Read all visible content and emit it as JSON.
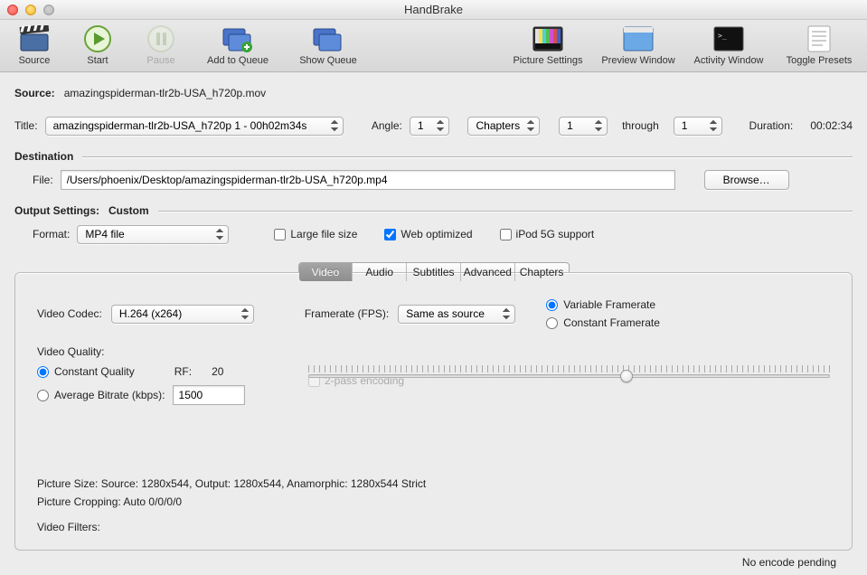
{
  "window": {
    "title": "HandBrake"
  },
  "toolbar_left": [
    {
      "label": "Source",
      "name": "source-button",
      "icon": "clapper"
    },
    {
      "label": "Start",
      "name": "start-button",
      "icon": "play"
    },
    {
      "label": "Pause",
      "name": "pause-button",
      "icon": "pause",
      "disabled": true
    },
    {
      "label": "Add to Queue",
      "name": "add-to-queue-button",
      "icon": "queue-add",
      "wide": true
    },
    {
      "label": "Show Queue",
      "name": "show-queue-button",
      "icon": "queue-show",
      "wide": true
    }
  ],
  "toolbar_right": [
    {
      "label": "Picture Settings",
      "name": "picture-settings-button",
      "icon": "test-pattern",
      "wide": true
    },
    {
      "label": "Preview Window",
      "name": "preview-window-button",
      "icon": "preview",
      "wide": true
    },
    {
      "label": "Activity Window",
      "name": "activity-window-button",
      "icon": "terminal",
      "wide": true
    },
    {
      "label": "Toggle Presets",
      "name": "toggle-presets-button",
      "icon": "presets",
      "wide": true
    }
  ],
  "source": {
    "head": "Source:",
    "value": "amazingspiderman-tlr2b-USA_h720p.mov",
    "title_label": "Title:",
    "title_value": "amazingspiderman-tlr2b-USA_h720p 1 - 00h02m34s",
    "angle_label": "Angle:",
    "angle_value": "1",
    "chapters_mode": "Chapters",
    "chapter_from": "1",
    "through": "through",
    "chapter_to": "1",
    "duration_label": "Duration:",
    "duration_value": "00:02:34"
  },
  "destination": {
    "head": "Destination",
    "file_label": "File:",
    "file_value": "/Users/phoenix/Desktop/amazingspiderman-tlr2b-USA_h720p.mp4",
    "browse": "Browse…"
  },
  "output": {
    "head": "Output Settings:",
    "head2": "Custom",
    "format_label": "Format:",
    "format_value": "MP4 file",
    "large_file": "Large file size",
    "web_opt": "Web optimized",
    "ipod": "iPod 5G support"
  },
  "tabs": [
    "Video",
    "Audio",
    "Subtitles",
    "Advanced",
    "Chapters"
  ],
  "video": {
    "codec_label": "Video Codec:",
    "codec_value": "H.264 (x264)",
    "fps_label": "Framerate (FPS):",
    "fps_value": "Same as source",
    "vfr": "Variable Framerate",
    "cfr": "Constant Framerate",
    "quality_head": "Video Quality:",
    "cq": "Constant Quality",
    "rf_label": "RF:",
    "rf_value": "20",
    "abr": "Average Bitrate (kbps):",
    "abr_value": "1500",
    "two_pass": "2-pass encoding",
    "picture_size": "Picture Size: Source: 1280x544, Output: 1280x544, Anamorphic: 1280x544 Strict",
    "picture_crop": "Picture Cropping: Auto 0/0/0/0",
    "vfilters": "Video Filters:"
  },
  "status": "No encode pending"
}
